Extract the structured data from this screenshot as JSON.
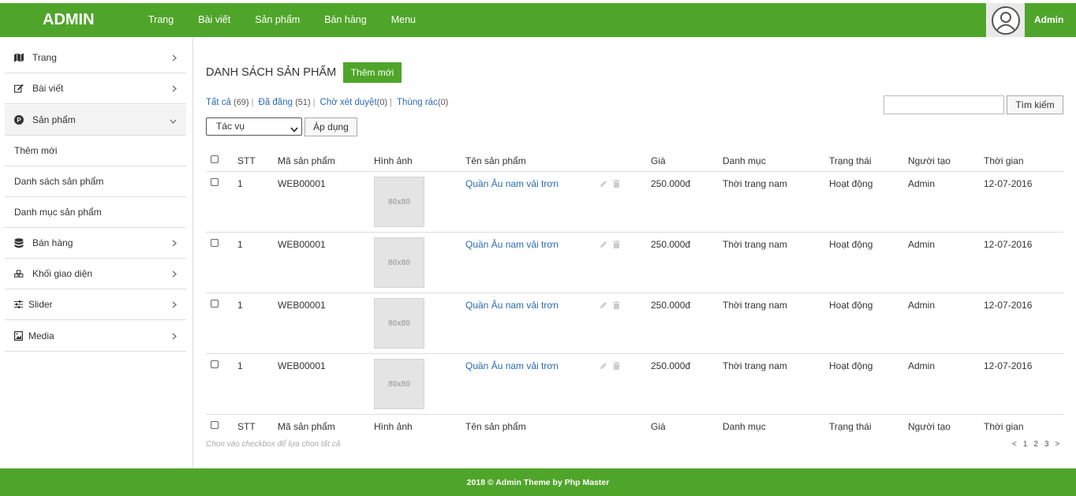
{
  "header": {
    "brand": "ADMIN",
    "nav": [
      "Trang",
      "Bài viết",
      "Sản phẩm",
      "Bán hàng",
      "Menu"
    ],
    "user": "Admin",
    "avatar_icon": "user-avatar-icon",
    "accent": "#4fa529"
  },
  "sidebar": {
    "items": [
      {
        "label": "Trang",
        "icon": "map-icon"
      },
      {
        "label": "Bài viết",
        "icon": "edit-icon"
      },
      {
        "label": "Sản phẩm",
        "icon": "product-icon"
      },
      {
        "label": "Thêm mới"
      },
      {
        "label": "Danh sách sản phẩm"
      },
      {
        "label": "Danh mục sản phẩm"
      },
      {
        "label": "Bán hàng",
        "icon": "database-icon"
      },
      {
        "label": "Khối giao diện",
        "icon": "cubes-icon"
      },
      {
        "label": "Slider",
        "icon": "sliders-icon"
      },
      {
        "label": "Media",
        "icon": "image-icon"
      }
    ]
  },
  "main": {
    "title": "DANH SÁCH SẢN PHẨM",
    "add_button": "Thêm mới",
    "filters": [
      {
        "label": "Tất cả",
        "count": "(69)"
      },
      {
        "label": "Đã đăng",
        "count": "(51)"
      },
      {
        "label": "Chờ xét duyệt",
        "count": "(0)"
      },
      {
        "label": "Thùng rác",
        "count": "(0)"
      }
    ],
    "bulk_select": "Tác vụ",
    "apply_button": "Áp dụng",
    "search_value": "",
    "search_button": "Tìm kiếm",
    "columns": [
      "STT",
      "Mã sản phẩm",
      "Hình ảnh",
      "Tên sản phẩm",
      "Giá",
      "Danh mục",
      "Trạng thái",
      "Người tạo",
      "Thời gian"
    ],
    "rows": [
      {
        "stt": "1",
        "code": "WEB00001",
        "img": "80x80",
        "name": "Quần Âu nam vải trơn",
        "price": "250.000đ",
        "category": "Thời trang nam",
        "status": "Hoạt động",
        "creator": "Admin",
        "date": "12-07-2016"
      },
      {
        "stt": "1",
        "code": "WEB00001",
        "img": "80x80",
        "name": "Quần Âu nam vải trơn",
        "price": "250.000đ",
        "category": "Thời trang nam",
        "status": "Hoạt động",
        "creator": "Admin",
        "date": "12-07-2016"
      },
      {
        "stt": "1",
        "code": "WEB00001",
        "img": "80x80",
        "name": "Quần Âu nam vải trơn",
        "price": "250.000đ",
        "category": "Thời trang nam",
        "status": "Hoạt động",
        "creator": "Admin",
        "date": "12-07-2016"
      },
      {
        "stt": "1",
        "code": "WEB00001",
        "img": "80x80",
        "name": "Quần Âu nam vải trơn",
        "price": "250.000đ",
        "category": "Thời trang nam",
        "status": "Hoạt động",
        "creator": "Admin",
        "date": "12-07-2016"
      }
    ],
    "hint": "Chọn vào checkbox để lựa chọn tất cả",
    "pagination": {
      "prev": "<",
      "pages": [
        "1",
        "2",
        "3"
      ],
      "next": ">"
    }
  },
  "footer": {
    "text": "2018 © Admin Theme by Php Master"
  }
}
